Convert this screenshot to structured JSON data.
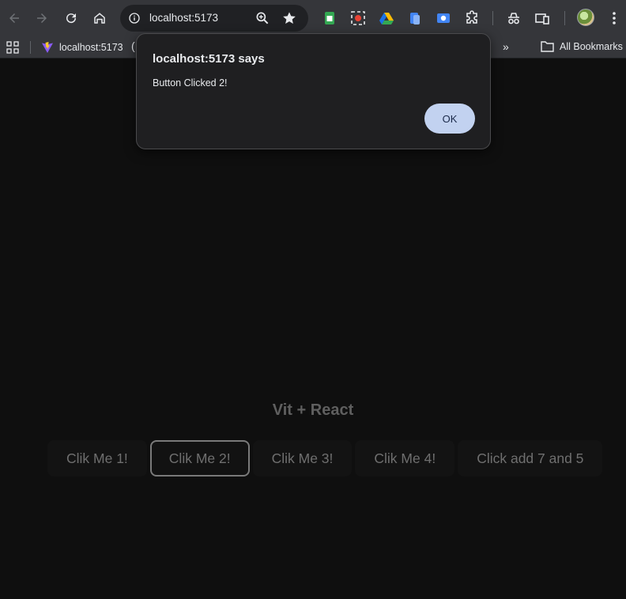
{
  "browser": {
    "url": "localhost:5173",
    "bookmarks": {
      "item_label": "localhost:5173",
      "overflow_label": "»",
      "all_bookmarks_label": "All Bookmarks"
    }
  },
  "page": {
    "heading": "Vit + React",
    "buttons": [
      {
        "label": "Clik Me 1!"
      },
      {
        "label": "Clik Me 2!"
      },
      {
        "label": "Clik Me 3!"
      },
      {
        "label": "Clik Me 4!"
      },
      {
        "label": "Click add 7 and 5"
      }
    ],
    "focused_button_index": 1
  },
  "alert": {
    "title": "localhost:5173 says",
    "message": "Button Clicked 2!",
    "ok_label": "OK"
  },
  "colors": {
    "toolbar_bg": "#35363a",
    "omnibox_bg": "#202124",
    "page_bg": "#0f0f0f",
    "dialog_bg": "#1f1f21",
    "ok_button_bg": "#c2d2f0"
  }
}
